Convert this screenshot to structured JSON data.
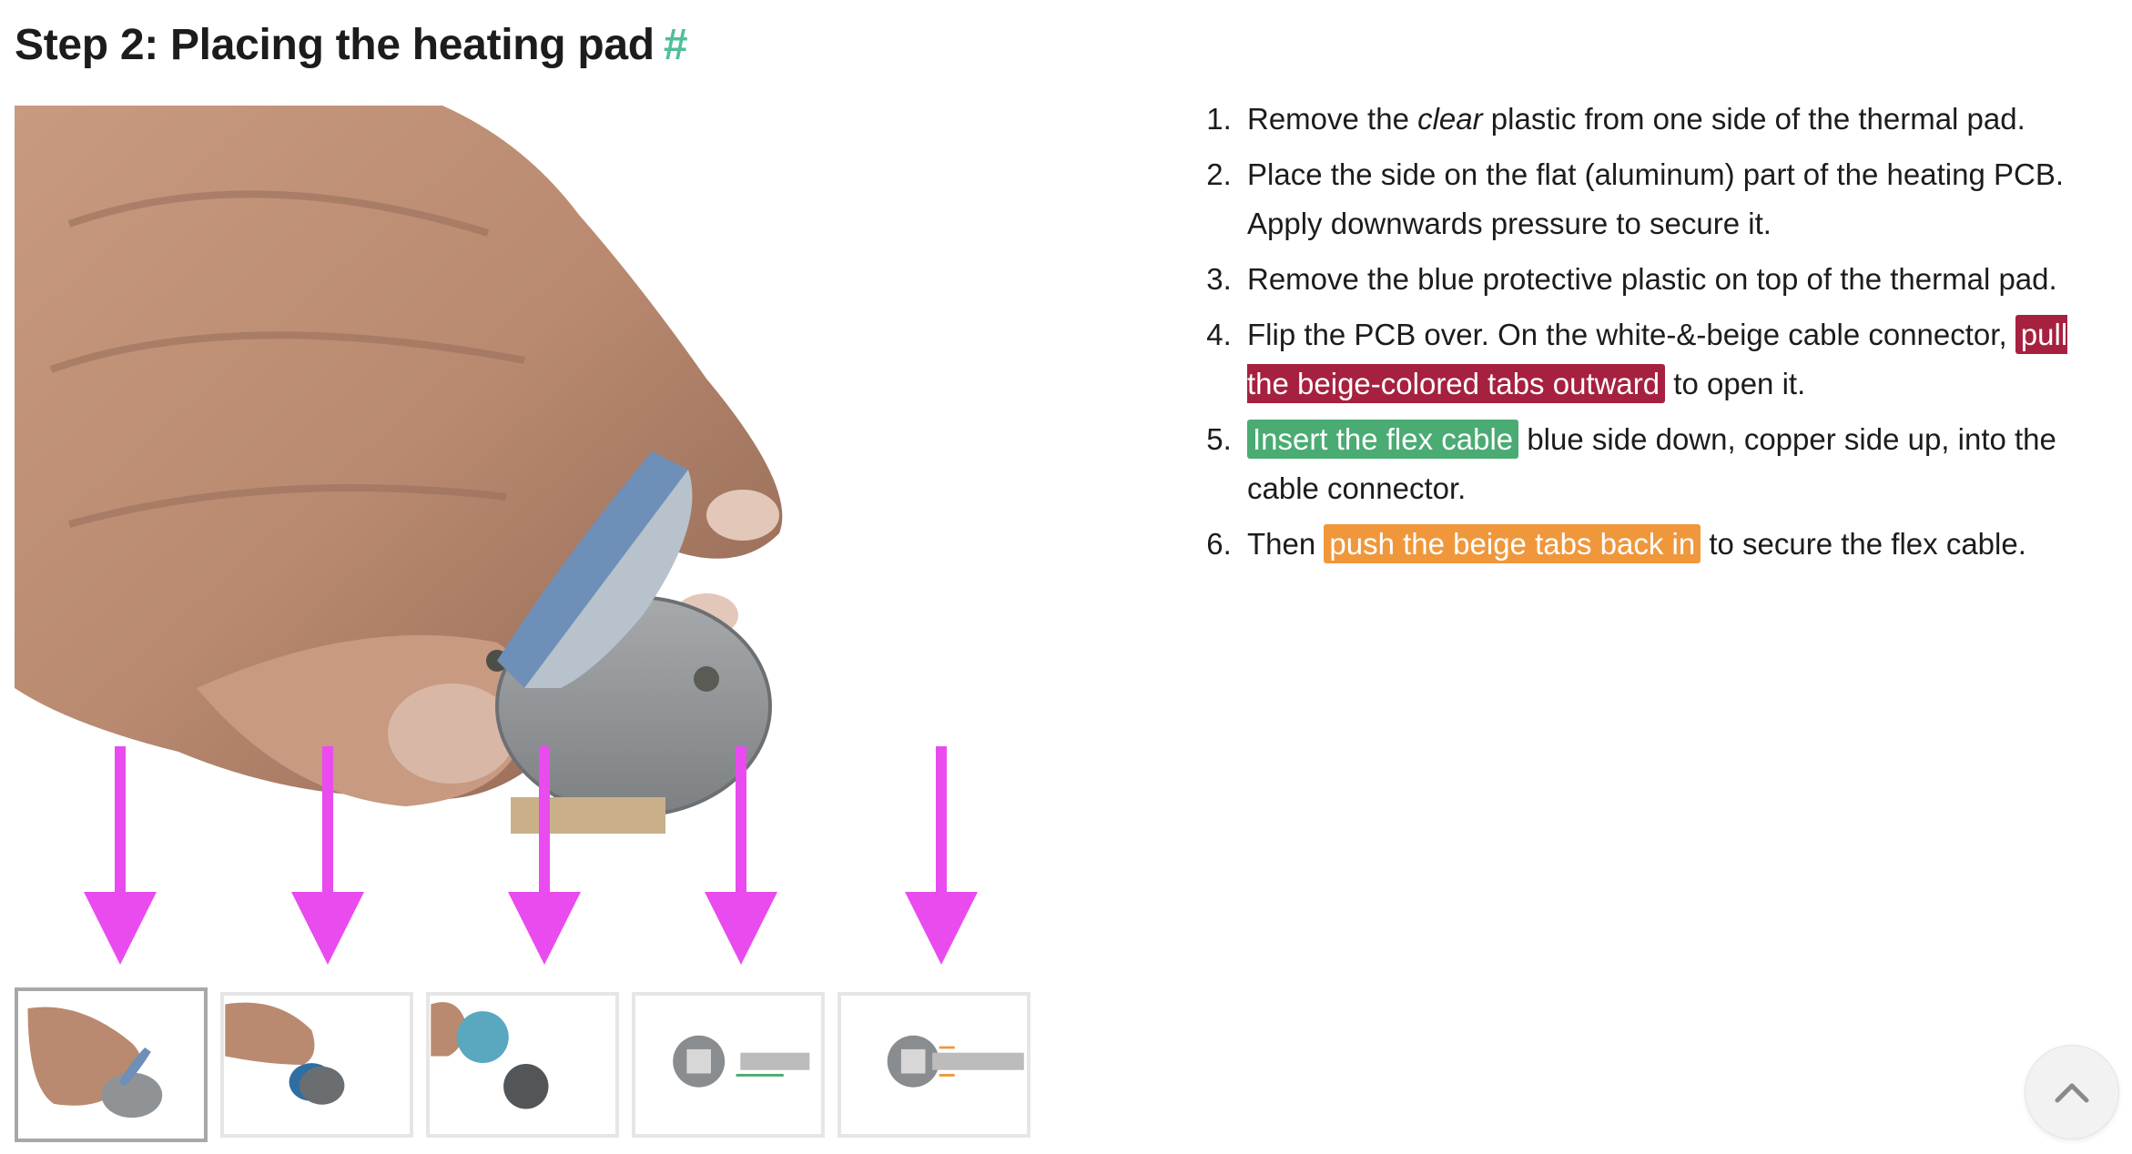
{
  "heading": {
    "title": "Step 2: Placing the heating pad",
    "anchor": "#"
  },
  "colors": {
    "arrow": "#e94bef",
    "highlight_red": "#a6213f",
    "highlight_green": "#4aab73",
    "highlight_orange": "#f0973b",
    "anchor": "#4fbf9b"
  },
  "steps": [
    {
      "before": "Remove the ",
      "emphasis": "clear",
      "after": " plastic from one side of the thermal pad."
    },
    {
      "text": "Place the side on the flat (aluminum) part of the heating PCB. Apply downwards pressure to secure it."
    },
    {
      "text": "Remove the blue protective plastic on top of the thermal pad."
    },
    {
      "before": "Flip the PCB over. On the white-&-beige cable connector, ",
      "highlight": "pull the beige-colored tabs outward",
      "after": " to open it."
    },
    {
      "before": "",
      "highlight": "Insert the flex cable",
      "after": " blue side down, copper side up, into the cable connector."
    },
    {
      "before": "Then ",
      "highlight": "push the beige tabs back in",
      "after": " to secure the flex cable."
    }
  ],
  "gallery": {
    "thumbnail_count": 5,
    "active_index": 0
  },
  "icons": {
    "scroll_top": "chevron-up-icon",
    "arrow": "arrow-down-icon"
  }
}
